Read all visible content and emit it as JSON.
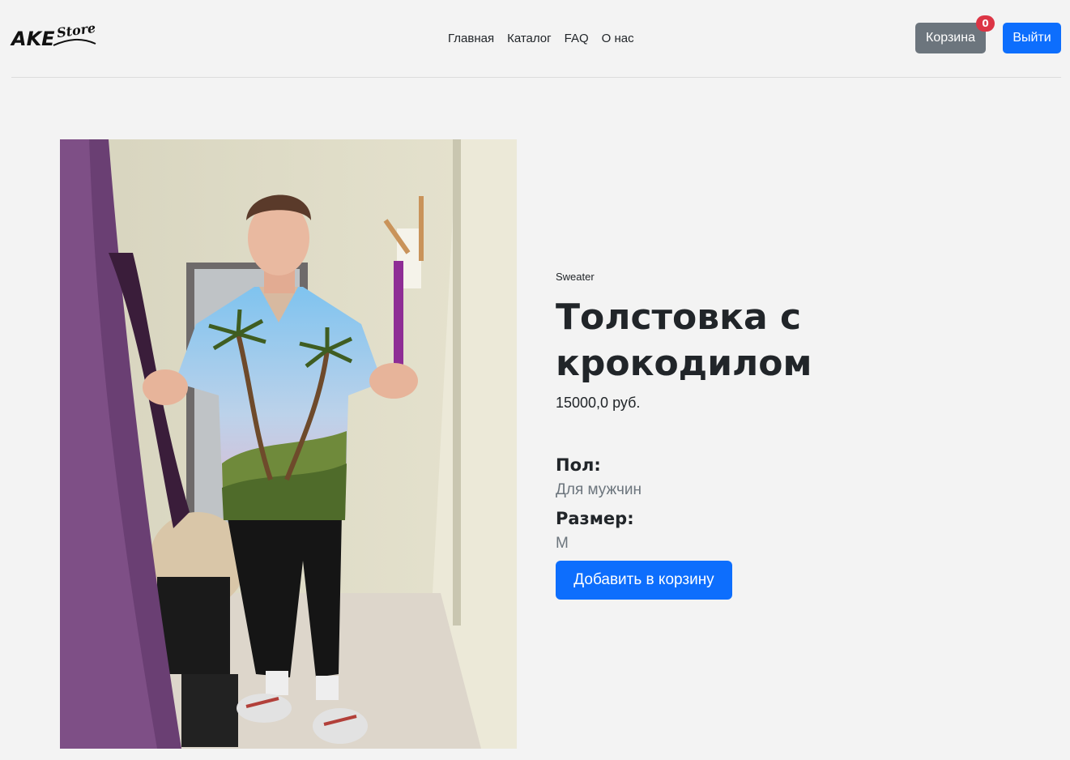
{
  "logo": {
    "main": "AKE",
    "sub": "Store"
  },
  "nav": {
    "items": [
      "Главная",
      "Каталог",
      "FAQ",
      "О нас"
    ]
  },
  "header": {
    "cart_label": "Корзина",
    "cart_count": "0",
    "logout_label": "Выйти"
  },
  "product": {
    "category": "Sweater",
    "title": "Толстовка с крокодилом",
    "price": "15000,0 руб.",
    "gender_label": "Пол:",
    "gender_value": "Для мужчин",
    "size_label": "Размер:",
    "size_value": "M",
    "add_to_cart_label": "Добавить в корзину"
  },
  "colors": {
    "primary": "#0d6efd",
    "secondary": "#6c757d",
    "badge": "#dc3545",
    "background": "#f3f3f3"
  }
}
